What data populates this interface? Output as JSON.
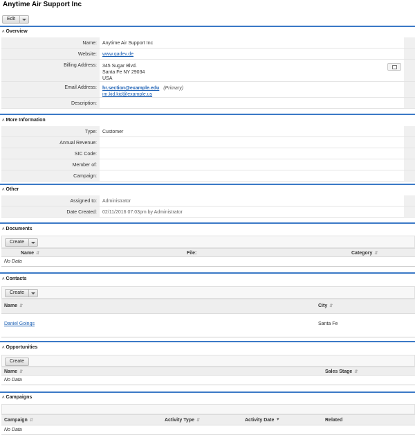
{
  "page_title": "Anytime Air Support Inc",
  "edit_button": {
    "label": "Edit"
  },
  "overview": {
    "title": "Overview",
    "rows": [
      {
        "label": "Name:",
        "value": "Anytime Air Support Inc"
      },
      {
        "label": "Website:",
        "value": "www.qadev.de"
      },
      {
        "label": "Billing Address:",
        "lines": [
          "345 Sugar Blvd.",
          "Santa Fe NY  29034",
          "USA"
        ]
      },
      {
        "label": "Email Address:",
        "emails": [
          {
            "address": "hr.section@example.edu",
            "note": "(Primary)"
          },
          {
            "address": "im.kid.kid@example.us"
          }
        ]
      },
      {
        "label": "Description:",
        "value": ""
      }
    ]
  },
  "more_info": {
    "title": "More Information",
    "rows": [
      {
        "label": "Type:",
        "value": "Customer"
      },
      {
        "label": "Annual Revenue:",
        "value": ""
      },
      {
        "label": "SIC Code:",
        "value": ""
      },
      {
        "label": "Member of:",
        "value": ""
      },
      {
        "label": "Campaign:",
        "value": ""
      }
    ]
  },
  "other": {
    "title": "Other",
    "rows": [
      {
        "label": "Assigned to:",
        "value": "Administrator"
      },
      {
        "label": "Date Created:",
        "value": "02/11/2016 07:03pm by Administrator"
      }
    ]
  },
  "documents": {
    "title": "Documents",
    "create_label": "Create",
    "columns": [
      "Name",
      "File:",
      "Category"
    ],
    "empty": "No Data"
  },
  "contacts": {
    "title": "Contacts",
    "create_label": "Create",
    "columns": [
      "Name",
      "City"
    ],
    "rows": [
      {
        "name": "Daniel Goings",
        "city": "Santa Fe"
      }
    ]
  },
  "opportunities": {
    "title": "Opportunities",
    "create_label": "Create",
    "columns": [
      "Name",
      "Sales Stage"
    ],
    "empty": "No Data"
  },
  "campaigns": {
    "title": "Campaigns",
    "columns": [
      "Campaign",
      "Activity Type",
      "Activity Date",
      "Related"
    ],
    "empty": "No Data"
  }
}
